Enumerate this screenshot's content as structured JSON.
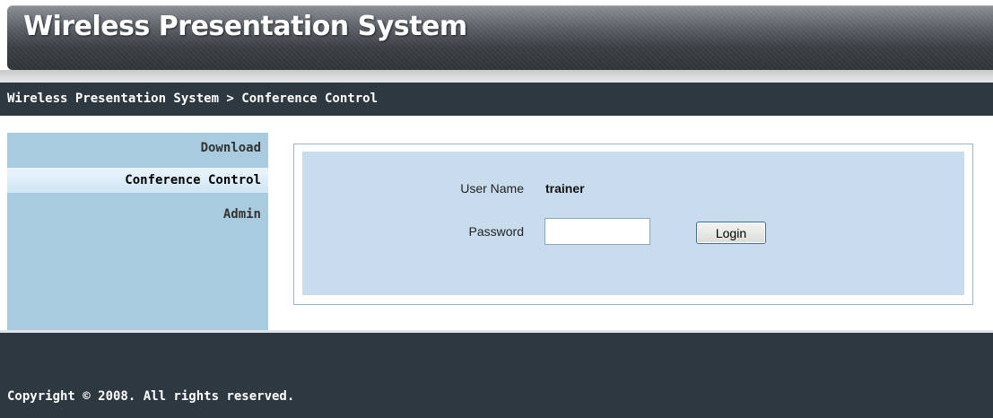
{
  "header": {
    "title": "Wireless Presentation System"
  },
  "breadcrumb": {
    "text": "Wireless Presentation System > Conference Control"
  },
  "sidebar": {
    "items": [
      {
        "label": "Download",
        "active": false
      },
      {
        "label": "Conference Control",
        "active": true
      },
      {
        "label": "Admin",
        "active": false
      }
    ]
  },
  "login": {
    "username_label": "User Name",
    "username_value": "trainer",
    "password_label": "Password",
    "password_value": "",
    "login_button": "Login"
  },
  "footer": {
    "copyright": "Copyright © 2008. All rights reserved."
  },
  "colors": {
    "header_dark": "#2f3438",
    "bar_dark": "#2e3840",
    "sidebar_bg": "#a9cbe0",
    "sidebar_active": "#eaf5fc",
    "panel_bg": "#c9dcee",
    "panel_border": "#9ab8cc"
  }
}
